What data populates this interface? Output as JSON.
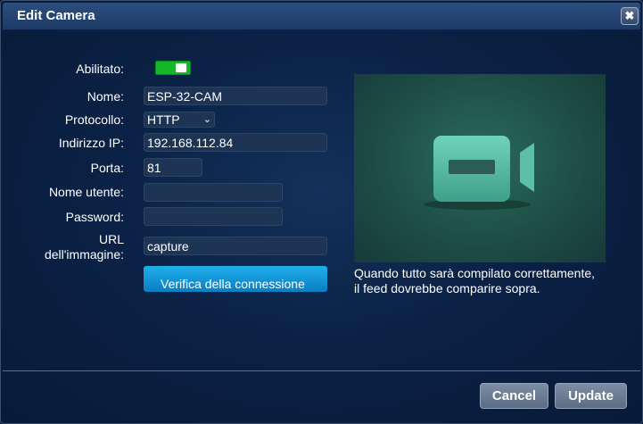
{
  "dialog": {
    "title": "Edit Camera",
    "close_glyph": "✖"
  },
  "form": {
    "enabled_label": "Abilitato:",
    "enabled": true,
    "name_label": "Nome:",
    "name_value": "ESP-32-CAM",
    "protocol_label": "Protocollo:",
    "protocol_value": "HTTP",
    "ip_label": "Indirizzo IP:",
    "ip_value": "192.168.112.84",
    "port_label": "Porta:",
    "port_value": "81",
    "username_label": "Nome utente:",
    "username_value": "",
    "password_label": "Password:",
    "password_value": "",
    "url_label_line1": "URL",
    "url_label_line2": "dell'immagine:",
    "url_value": "capture",
    "verify_button": "Verifica della connessione"
  },
  "preview": {
    "icon": "video-camera-icon",
    "caption_line1": "Quando tutto sarà compilato correttamente,",
    "caption_line2": "il feed dovrebbe comparire sopra."
  },
  "footer": {
    "cancel_label": "Cancel",
    "update_label": "Update"
  },
  "colors": {
    "toggle_on": "#16b629",
    "primary": "#0f95d6",
    "preview_bg": "#1e4f46",
    "icon_color": "#5ec0a8"
  }
}
